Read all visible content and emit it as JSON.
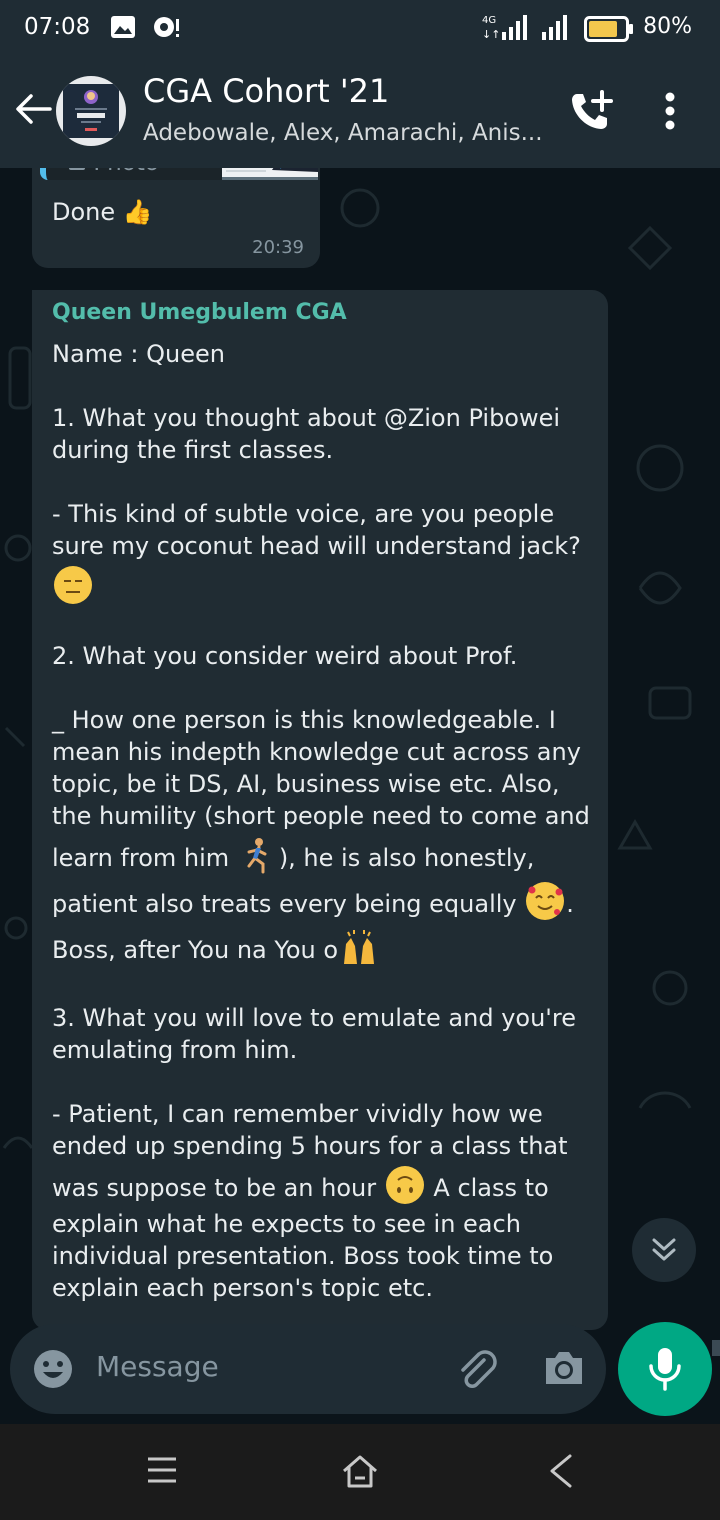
{
  "status_bar": {
    "time": "07:08",
    "network_label": "4G",
    "battery_percent": "80%",
    "battery_level": 0.8
  },
  "header": {
    "title": "CGA Cohort '21",
    "subtitle": "Adebowale, Alex, Amarachi, Anis..."
  },
  "messages": [
    {
      "quoted_label": "Photo",
      "text": "Done 👍",
      "time": "20:39"
    },
    {
      "sender": "Queen Umegbulem CGA",
      "paragraphs": [
        "Name : Queen",
        "1. What you thought about @Zion Pibowei during the first classes.",
        "- This kind of subtle voice, are you people sure my coconut head will understand jack?",
        "2. What you consider weird about Prof.",
        "_ How one person is this knowledgeable. I mean his indepth knowledge cut across any topic, be it DS, AI, business wise etc. Also, the humility (short people need to come and learn from him",
        "), he is also honestly, patient also treats every being equally",
        ". Boss, after You na You o",
        "3. What you will love to emulate and you're emulating from him.",
        "- Patient, I can remember vividly how we ended up spending 5 hours for a class that was suppose to be an hour",
        "A class to explain what he expects to see in each individual presentation. Boss took time to explain each person's topic etc."
      ]
    }
  ],
  "input": {
    "placeholder": "Message"
  },
  "icons": {
    "back": "arrow-left-icon",
    "call": "add-call-icon",
    "more": "more-vert-icon",
    "emoji": "emoji-icon",
    "attach": "paperclip-icon",
    "camera": "camera-icon",
    "mic": "microphone-icon",
    "scroll": "double-chevron-down-icon"
  },
  "colors": {
    "accent": "#00a884",
    "sender_name": "#53bdab",
    "bubble": "#202c33",
    "header": "#1f2c34",
    "chat_bg": "#0b141a"
  }
}
